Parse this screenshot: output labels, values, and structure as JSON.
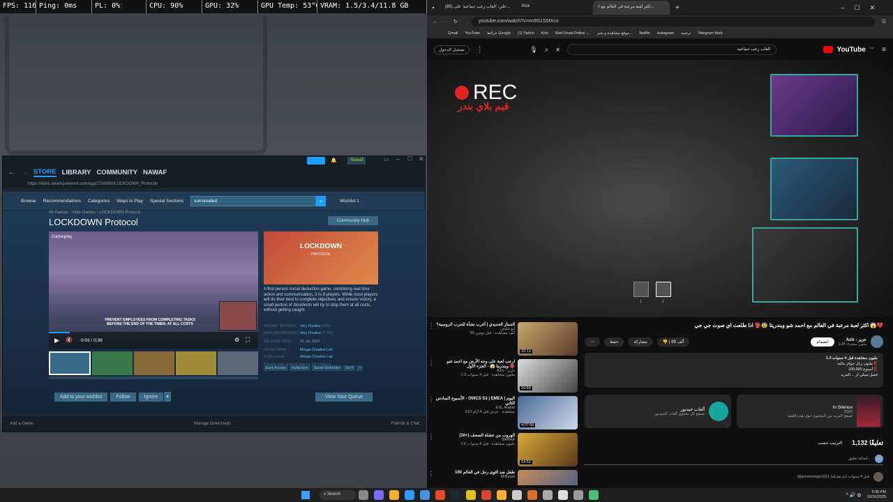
{
  "osd": {
    "fps": "FPS: 116",
    "ping": "Ping: 0ms",
    "pl": "PL: 0%",
    "cpu": "CPU: 90%",
    "gpu": "GPU: 32%",
    "gpu_temp": "GPU Temp: 53°C",
    "vram": "VRAM: 1.5/3.4/11.8 GB"
  },
  "steam": {
    "nav": {
      "store": "STORE",
      "library": "LIBRARY",
      "community": "COMMUNITY",
      "user": "NAWAF"
    },
    "username": "Nawaf",
    "url": "https://store.steampowered.com/app/2780980/LOCKDOWN_Protocol/",
    "menu": {
      "browse": "Browse",
      "recommendations": "Recommendations",
      "categories": "Categories",
      "ways": "Ways to Play",
      "special": "Special Sections",
      "search_value": "surrounded",
      "wishlist": "Wishlist 1"
    },
    "breadcrumb": "All Games › Indie Games › LOCKDOWN Protocol",
    "title": "LOCKDOWN Protocol",
    "hub": "Community Hub",
    "gameplay": "Gameplay",
    "banner_text": "PREVENT EMPLOYEES FROM COMPLETING TASKS BEFORE THE END OF THE TIMER, AT ALL COSTS",
    "time": "0:03 / 0:39",
    "logo": "LOCKDOWN",
    "logo_sub": "PROTOCOL",
    "desc": "A first person social deduction game, combining real time action and communication, 3 to 8 players. While most players will do their best to complete objectives and ensure victory, a small portion of dissidents will try to stop them at all costs, without getting caught.",
    "recent_label": "RECENT REVIEWS:",
    "recent_value": "Very Positive",
    "recent_count": "(304)",
    "english_label": "ENGLISH REVIEWS:",
    "english_value": "Very Positive",
    "english_count": "(7,359)",
    "release_label": "RELEASE DATE:",
    "release_value": "22 Jul, 2024",
    "dev_label": "DEVELOPER:",
    "dev_value": "Mirage Creative Lab",
    "pub_label": "PUBLISHER:",
    "pub_value": "Mirage Creative Lab",
    "tags_label": "Popular user-defined tags for this product:",
    "tags": [
      "Early Access",
      "Multiplayer",
      "Social Deduction",
      "Sci-fi",
      "+"
    ],
    "add_wishlist": "Add to your wishlist",
    "follow": "Follow",
    "ignore": "Ignore",
    "queue": "View Your Queue",
    "add_game": "Add a Game",
    "manage": "Manage Downloads",
    "friends": "Friends & Chat"
  },
  "browser": {
    "tabs": [
      "(85) علي: 'العاب رعب جماعية' على...",
      "Kick",
      "اكثر لعبة مرعبة في العالم مع ا..."
    ],
    "url": "youtube.com/watch?v=nn9S1S5IXco",
    "bookmarks": [
      "Gmail",
      "YouTube",
      "خرائط Google",
      "(1) Twitch",
      "Kick",
      "Red Dead Online -...",
      "موقع مشاهدة و تحم...",
      "Netflix",
      "Instagram",
      "ترجمة",
      "Telegram Web"
    ],
    "signin": "تسجيل الدخول",
    "search_value": "العاب رعب جماعيه",
    "yt_logo": "YouTube",
    "yt_sa": "SA",
    "rec": "REC",
    "channel_tag": "قيم بلاي بندر",
    "slot1": "1",
    "slot2": "2",
    "title": "اكثر لعبة مرعبة في العالم مع احمد شو وبندريتا 😨👺 اذا طلعت اي صوت جي جي 😱💔",
    "channel": "Aziz - عزيز",
    "subs": "3.24 مليون مشترك",
    "join": "انضمام",
    "likes": "89 ألف",
    "share": "مشاركة",
    "save": "حفظ",
    "views": "1.3 مليون مشاهدة  قبل 4 سنوات",
    "desc_lines": [
      "مليون ريال جوائز مالية‼️",
      "100,000 أسبوع‼️",
      "فصل سيلي از ... المزيد"
    ],
    "card1_title": "In Silence",
    "card1_year": "2020",
    "card1_more": "تصفح المزيد من المحتوى حول هذه اللعبة",
    "card2_title": "ألعاب جيدبور",
    "card2_more": "تصفح كل محتوى ألعاب الجيدبور",
    "comments_count": "1,132 تعليقًا",
    "sort": "الترتيب حسب",
    "add_comment": "إضافة تعليق...",
    "comment_user": "@greenwings1021 قبل 4 سنوات (تم تعديله)",
    "related": [
      {
        "title": "الستار الحديدي | أغرب نشأة للحرب الروسية؟",
        "channel": "أبو عليص",
        "meta": "99 ألف مشاهدة · قبل يومين",
        "dur": "33:13"
      },
      {
        "title": "ارعب لعبة على وجه الأرض مع احمد شو وبندريتا 😱 - الجزء الأول 👺",
        "channel": "Aziz - عزيز",
        "meta": "2.2 مليون مشاهدة · قبل 4 سنوات",
        "dur": "16:50"
      },
      {
        "title": "الأسبوع السادس - OWCS S3 | EMEA | اليوم الثاني",
        "channel": "ESL Arabia",
        "meta": "519 مشاهدة · عرض قبل 4 أيام",
        "dur": "4:07:56"
      },
      {
        "title": "الهروب من عشلة الصحف (+16)",
        "channel": "BARAA",
        "meta": "2.6 مليون مشاهدة · قبل 4 سنوات",
        "dur": "13:52"
      },
      {
        "title": "100 طفل ضد أقوى رجل في العالم",
        "channel": "MrBeast",
        "meta": "",
        "dur": ""
      }
    ]
  },
  "taskbar": {
    "search": "Search",
    "time": "9:35 PM",
    "date": "10/16/2025"
  }
}
